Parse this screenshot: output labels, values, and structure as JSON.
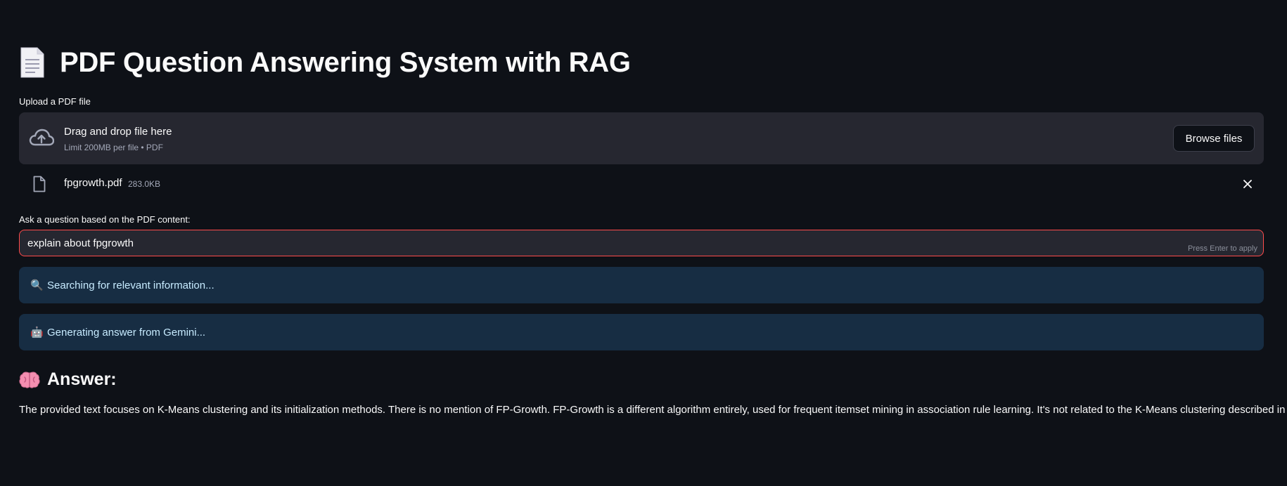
{
  "app": {
    "title": "PDF Question Answering System with RAG",
    "title_icon": "page-document-icon",
    "accent_color": "#ff4b4b",
    "background_color": "#0e1117"
  },
  "upload": {
    "label": "Upload a PDF file",
    "drop_title": "Drag and drop file here",
    "drop_subtitle": "Limit 200MB per file • PDF",
    "browse_label": "Browse files",
    "file": {
      "name": "fpgrowth.pdf",
      "size": "283.0KB"
    }
  },
  "question": {
    "label": "Ask a question based on the PDF content:",
    "value": "explain about fpgrowth",
    "hint": "Press Enter to apply"
  },
  "status": {
    "searching": "Searching for relevant information...",
    "searching_icon": "magnifier-icon",
    "generating": "Generating answer from Gemini...",
    "generating_icon": "robot-icon"
  },
  "answer": {
    "heading": "Answer:",
    "heading_icon": "brain-icon",
    "text": "The provided text focuses on K-Means clustering and its initialization methods. There is no mention of FP-Growth. FP-Growth is a different algorithm entirely, used for frequent itemset mining in association rule learning. It's not related to the K-Means clustering described in the text."
  }
}
